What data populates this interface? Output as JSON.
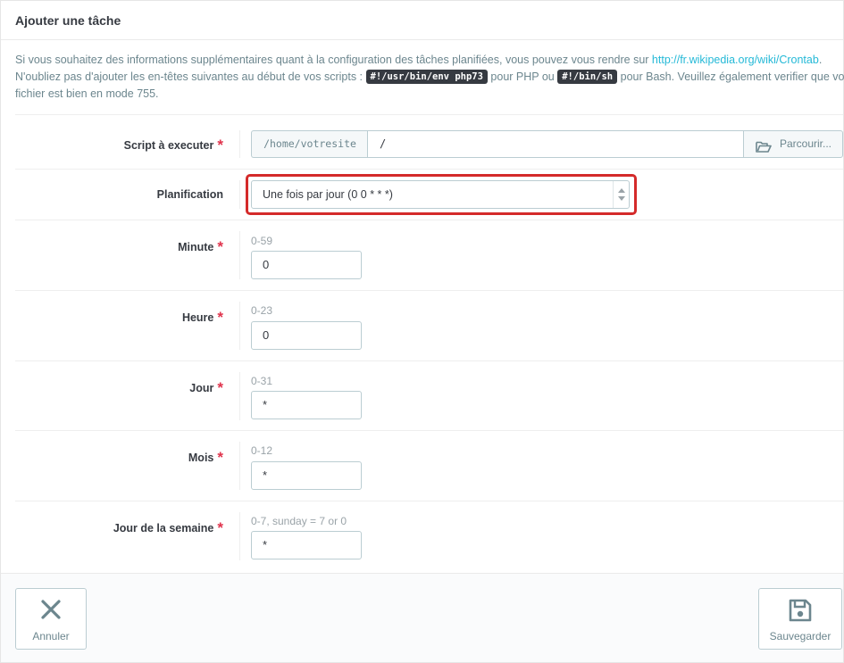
{
  "panel": {
    "title": "Ajouter une tâche"
  },
  "help": {
    "line1_text": "Si vous souhaitez des informations supplémentaires quant à la configuration des tâches planifiées, vous pouvez vous rendre sur ",
    "line1_link": "http://fr.wikipedia.org/wiki/Crontab",
    "line1_end": ".",
    "line2_a": "N'oubliez pas d'ajouter les en-têtes suivantes au début de vos scripts : ",
    "code_php": "#!/usr/bin/env php73",
    "line2_b": " pour PHP ou ",
    "code_bash": "#!/bin/sh",
    "line2_c": " pour Bash. Veuillez également verifier que votre",
    "line3": "fichier est bien en mode 755."
  },
  "script": {
    "label": "Script à executer",
    "path_prefix": "/home/votresite",
    "path_value": "/",
    "browse_label": "Parcourir..."
  },
  "planification": {
    "label": "Planification",
    "selected": "Une fois par jour (0 0 * * *)"
  },
  "fields": {
    "minute": {
      "label": "Minute",
      "hint": "0-59",
      "value": "0"
    },
    "heure": {
      "label": "Heure",
      "hint": "0-23",
      "value": "0"
    },
    "jour": {
      "label": "Jour",
      "hint": "0-31",
      "value": "*"
    },
    "mois": {
      "label": "Mois",
      "hint": "0-12",
      "value": "*"
    },
    "jour_semaine": {
      "label": "Jour de la semaine",
      "hint": "0-7, sunday = 7 or 0",
      "value": "*"
    }
  },
  "footer": {
    "cancel_label": "Annuler",
    "save_label": "Sauvegarder"
  },
  "colors": {
    "required": "#e0334c",
    "link": "#25b9d7",
    "highlight": "#d42a2a"
  },
  "icons": {
    "browse": "folder-open-icon",
    "cancel": "close-icon",
    "save": "save-icon"
  }
}
